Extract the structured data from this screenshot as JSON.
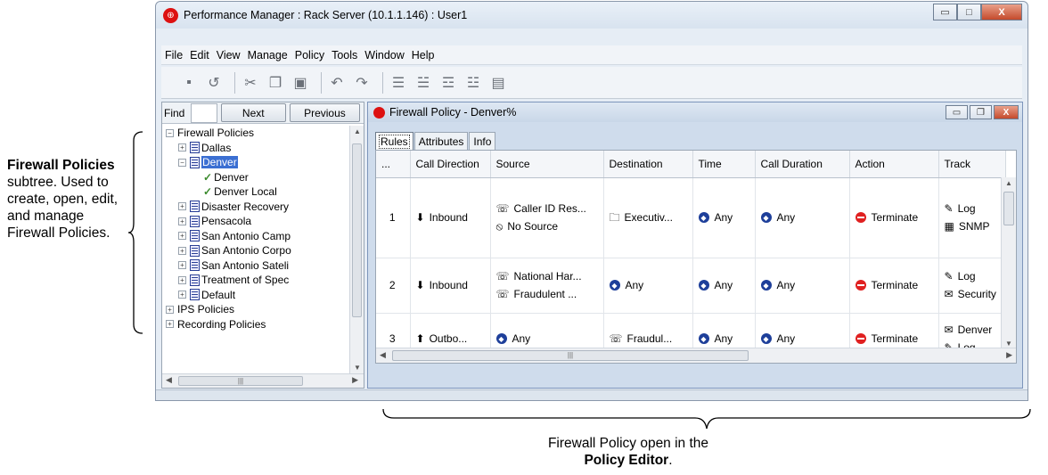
{
  "annotations": {
    "left_bold": "Firewall Policies",
    "left_text": "subtree. Used to create, open, edit, and manage Firewall Policies.",
    "bottom_text": "Firewall Policy open in the",
    "bottom_bold": "Policy Editor",
    "bottom_end": "."
  },
  "window": {
    "title": "Performance Manager : Rack Server (10.1.1.146) : User1",
    "controls": {
      "minimize": "▭",
      "maximize": "□",
      "close": "X"
    }
  },
  "menu": [
    "File",
    "Edit",
    "View",
    "Manage",
    "Policy",
    "Tools",
    "Window",
    "Help"
  ],
  "toolbar": {
    "icons": [
      "save-icon",
      "revert-icon",
      "cut-icon",
      "copy-icon",
      "paste-icon",
      "undo-icon",
      "redo-icon",
      "insert-row-icon",
      "insert-above-icon",
      "insert-below-icon",
      "move-icon",
      "delete-row-icon"
    ]
  },
  "find": {
    "label": "Find",
    "value": "",
    "next": "Next",
    "previous": "Previous"
  },
  "tree": [
    {
      "label": "Firewall Policies",
      "level": 0,
      "expander": "−"
    },
    {
      "label": "Dallas",
      "level": 1,
      "expander": "+",
      "doc": true
    },
    {
      "label": "Denver",
      "level": 1,
      "expander": "−",
      "doc": true,
      "selected": true
    },
    {
      "label": "Denver",
      "level": 2,
      "check": true
    },
    {
      "label": "Denver Local",
      "level": 2,
      "check": true
    },
    {
      "label": "Disaster Recovery",
      "level": 1,
      "expander": "+",
      "doc": true
    },
    {
      "label": "Pensacola",
      "level": 1,
      "expander": "+",
      "doc": true
    },
    {
      "label": "San Antonio Camp",
      "level": 1,
      "expander": "+",
      "doc": true
    },
    {
      "label": "San Antonio Corpo",
      "level": 1,
      "expander": "+",
      "doc": true
    },
    {
      "label": "San Antonio Sateli",
      "level": 1,
      "expander": "+",
      "doc": true
    },
    {
      "label": "Treatment of Spec",
      "level": 1,
      "expander": "+",
      "doc": true
    },
    {
      "label": "Default",
      "level": 1,
      "expander": "+",
      "doc": true
    },
    {
      "label": "IPS Policies",
      "level": 0,
      "expander": "+"
    },
    {
      "label": "Recording Policies",
      "level": 0,
      "expander": "+"
    }
  ],
  "editor": {
    "title": "Firewall Policy - Denver%",
    "tabs": [
      "Rules",
      "Attributes",
      "Info"
    ],
    "columns": [
      "...",
      "Call Direction",
      "Source",
      "Destination",
      "Time",
      "Call Duration",
      "Action",
      "Track"
    ],
    "rows": [
      {
        "num": "1",
        "direction": "Inbound",
        "source": [
          "Caller ID Res...",
          "No Source"
        ],
        "destination": [
          "Executiv..."
        ],
        "time": "Any",
        "duration": "Any",
        "action": "Terminate",
        "track": [
          "Log",
          "SNMP"
        ]
      },
      {
        "num": "2",
        "direction": "Inbound",
        "source": [
          "National Har...",
          "Fraudulent ..."
        ],
        "destination": [
          "Any"
        ],
        "time": "Any",
        "duration": "Any",
        "action": "Terminate",
        "track": [
          "Log",
          "Security"
        ]
      },
      {
        "num": "3",
        "direction": "Outbo...",
        "source": [
          "Any"
        ],
        "destination": [
          "Fraudul..."
        ],
        "time": "Any",
        "duration": "Any",
        "action": "Terminate",
        "track": [
          "Denver",
          "Log"
        ]
      }
    ]
  }
}
